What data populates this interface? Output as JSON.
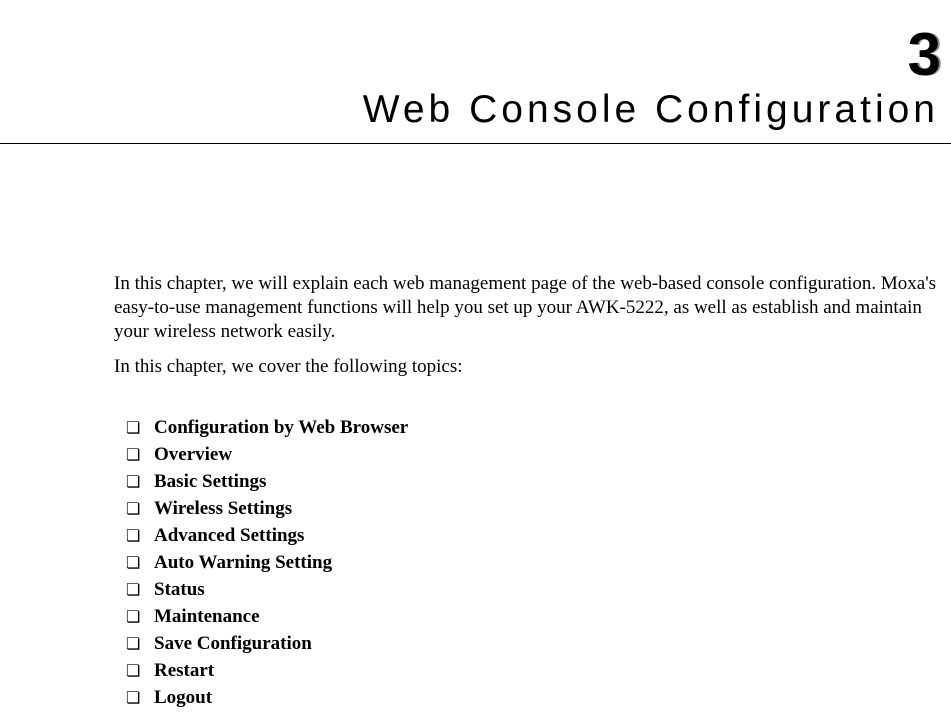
{
  "chapter": {
    "number": "3",
    "title": "Web Console Configuration"
  },
  "intro": {
    "para1": "In this chapter, we will explain each web management page of the web-based console configuration. Moxa's easy-to-use management functions will help you set up your AWK-5222, as well as establish and maintain your wireless network easily.",
    "para2": "In this chapter, we cover the following topics:"
  },
  "bullet_glyph": "❏",
  "topics": [
    "Configuration by Web Browser",
    "Overview",
    "Basic Settings",
    "Wireless Settings",
    "Advanced Settings",
    "Auto Warning Setting",
    "Status",
    "Maintenance",
    "Save Configuration",
    "Restart",
    "Logout"
  ]
}
